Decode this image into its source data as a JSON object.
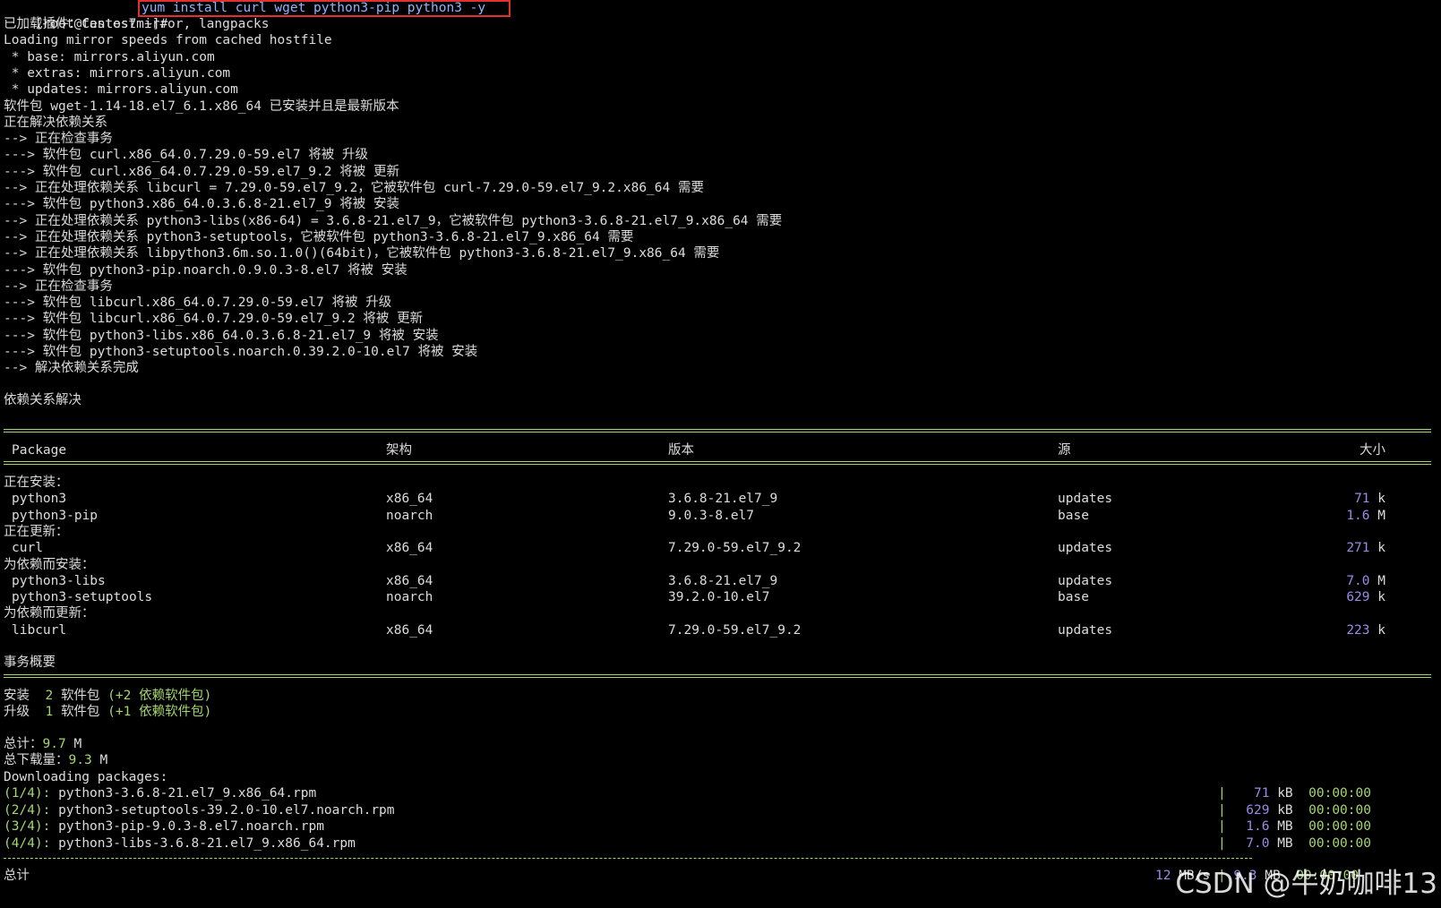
{
  "prompt": {
    "text": "[root@Centos7 ~]#",
    "command": "yum install curl wget python3-pip python3 -y"
  },
  "log_top": [
    "已加载插件：fastestmirror, langpacks",
    "Loading mirror speeds from cached hostfile",
    " * base: mirrors.aliyun.com",
    " * extras: mirrors.aliyun.com",
    " * updates: mirrors.aliyun.com",
    "软件包 wget-1.14-18.el7_6.1.x86_64 已安装并且是最新版本",
    "正在解决依赖关系",
    "--> 正在检查事务",
    "---> 软件包 curl.x86_64.0.7.29.0-59.el7 将被 升级",
    "---> 软件包 curl.x86_64.0.7.29.0-59.el7_9.2 将被 更新",
    "--> 正在处理依赖关系 libcurl = 7.29.0-59.el7_9.2，它被软件包 curl-7.29.0-59.el7_9.2.x86_64 需要",
    "---> 软件包 python3.x86_64.0.3.6.8-21.el7_9 将被 安装",
    "--> 正在处理依赖关系 python3-libs(x86-64) = 3.6.8-21.el7_9，它被软件包 python3-3.6.8-21.el7_9.x86_64 需要",
    "--> 正在处理依赖关系 python3-setuptools，它被软件包 python3-3.6.8-21.el7_9.x86_64 需要",
    "--> 正在处理依赖关系 libpython3.6m.so.1.0()(64bit)，它被软件包 python3-3.6.8-21.el7_9.x86_64 需要",
    "---> 软件包 python3-pip.noarch.0.9.0.3-8.el7 将被 安装",
    "--> 正在检查事务",
    "---> 软件包 libcurl.x86_64.0.7.29.0-59.el7 将被 升级",
    "---> 软件包 libcurl.x86_64.0.7.29.0-59.el7_9.2 将被 更新",
    "---> 软件包 python3-libs.x86_64.0.3.6.8-21.el7_9 将被 安装",
    "---> 软件包 python3-setuptools.noarch.0.39.2.0-10.el7 将被 安装",
    "--> 解决依赖关系完成"
  ],
  "resolved": "依赖关系解决",
  "table": {
    "headers": {
      "package": "Package",
      "arch": "架构",
      "version": "版本",
      "repo": "源",
      "size": "大小"
    },
    "groups": [
      {
        "label": "正在安装：",
        "rows": [
          {
            "package": "python3",
            "arch": "x86_64",
            "version": "3.6.8-21.el7_9",
            "repo": "updates",
            "size": "71",
            "unit": "k"
          },
          {
            "package": "python3-pip",
            "arch": "noarch",
            "version": "9.0.3-8.el7",
            "repo": "base",
            "size": "1.6",
            "unit": "M"
          }
        ]
      },
      {
        "label": "正在更新：",
        "rows": [
          {
            "package": "curl",
            "arch": "x86_64",
            "version": "7.29.0-59.el7_9.2",
            "repo": "updates",
            "size": "271",
            "unit": "k"
          }
        ]
      },
      {
        "label": "为依赖而安装：",
        "rows": [
          {
            "package": "python3-libs",
            "arch": "x86_64",
            "version": "3.6.8-21.el7_9",
            "repo": "updates",
            "size": "7.0",
            "unit": "M"
          },
          {
            "package": "python3-setuptools",
            "arch": "noarch",
            "version": "39.2.0-10.el7",
            "repo": "base",
            "size": "629",
            "unit": "k"
          }
        ]
      },
      {
        "label": "为依赖而更新：",
        "rows": [
          {
            "package": "libcurl",
            "arch": "x86_64",
            "version": "7.29.0-59.el7_9.2",
            "repo": "updates",
            "size": "223",
            "unit": "k"
          }
        ]
      }
    ]
  },
  "summary": {
    "title": "事务概要",
    "install": {
      "label": "安装",
      "count": "2",
      "unit": "软件包",
      "dep_open": "(+2",
      "dep_text": "依赖软件包)"
    },
    "upgrade": {
      "label": "升级",
      "count": "1",
      "unit": "软件包",
      "dep_open": "(+1",
      "dep_text": "依赖软件包)"
    },
    "total": {
      "label": "总计：",
      "value": "9.7",
      "unit": "M"
    },
    "download": {
      "label": "总下载量：",
      "value": "9.3",
      "unit": "M"
    }
  },
  "downloading": {
    "title": "Downloading packages:",
    "files": [
      {
        "index": "(1/4):",
        "name": "python3-3.6.8-21.el7_9.x86_64.rpm",
        "size": "71",
        "unit": "kB",
        "time": "00:00:00"
      },
      {
        "index": "(2/4):",
        "name": "python3-setuptools-39.2.0-10.el7.noarch.rpm",
        "size": "629",
        "unit": "kB",
        "time": "00:00:00"
      },
      {
        "index": "(3/4):",
        "name": "python3-pip-9.0.3-8.el7.noarch.rpm",
        "size": "1.6",
        "unit": "MB",
        "time": "00:00:00"
      },
      {
        "index": "(4/4):",
        "name": "python3-libs-3.6.8-21.el7_9.x86_64.rpm",
        "size": "7.0",
        "unit": "MB",
        "time": "00:00:00"
      }
    ],
    "total": {
      "label": "总计",
      "speed": "12",
      "speed_unit": "MB/s",
      "size": "9.3",
      "size_unit": "MB",
      "time": "00:00:00"
    }
  },
  "watermark": "CSDN @牛奶咖啡13",
  "colors": {
    "background": "#000000",
    "text": "#dcdcdc",
    "accent": "#a5d66b",
    "number": "#9b8ae6",
    "highlight_box": "#e03030"
  }
}
